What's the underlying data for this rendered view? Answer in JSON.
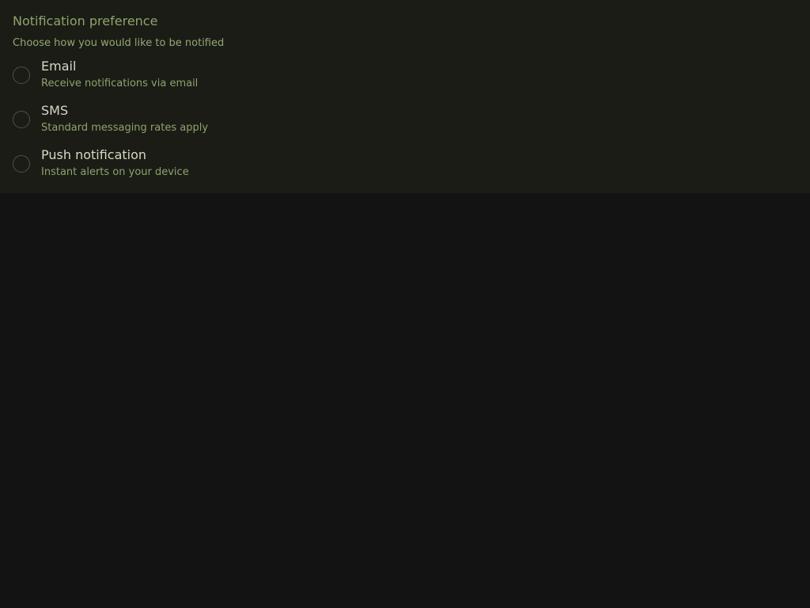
{
  "fieldset": {
    "title": "Notification preference",
    "subtitle": "Choose how you would like to be notified",
    "options": [
      {
        "label": "Email",
        "description": "Receive notifications via email",
        "selected": false
      },
      {
        "label": "SMS",
        "description": "Standard messaging rates apply",
        "selected": false
      },
      {
        "label": "Push notification",
        "description": "Instant alerts on your device",
        "selected": false
      }
    ]
  },
  "colors": {
    "panel_bg": "#1b1c16",
    "page_bg": "#131313",
    "accent_text": "#8da46c",
    "label_text": "#d9d6c4",
    "radio_border": "#4d5242"
  }
}
